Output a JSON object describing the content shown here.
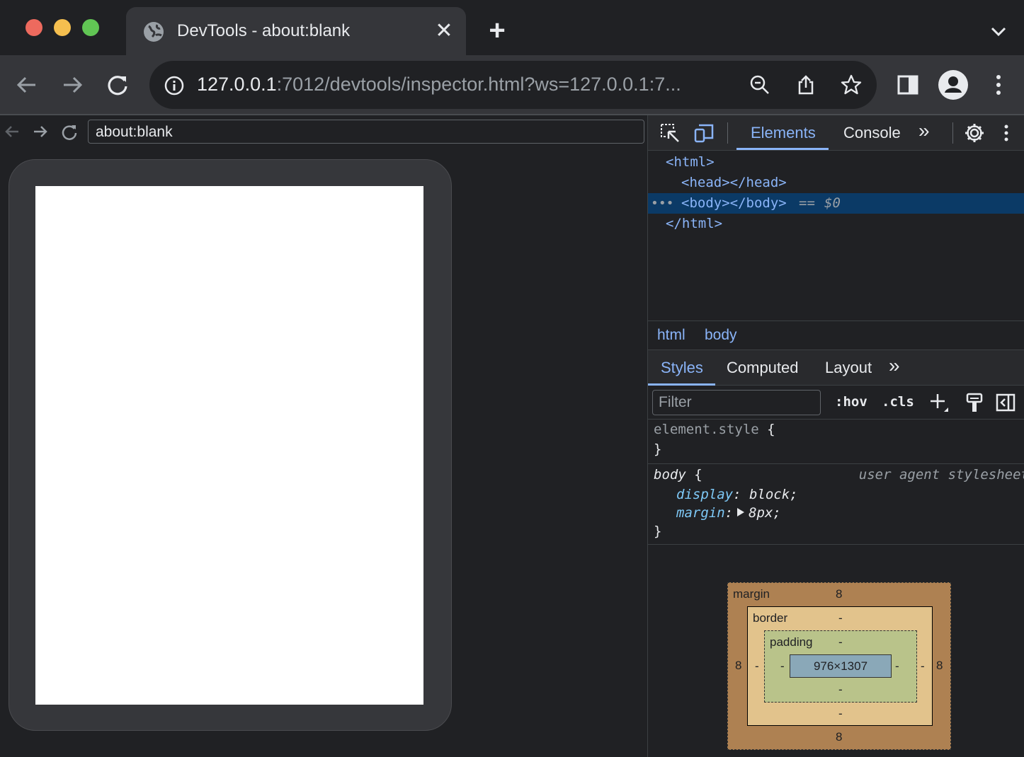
{
  "browser": {
    "tab_title": "DevTools - about:blank",
    "tab_close": "✕",
    "new_tab": "+",
    "url_host": "127.0.0.1",
    "url_rest": ":7012/devtools/inspector.html?ws=127.0.0.1:7..."
  },
  "screencast": {
    "url": "about:blank"
  },
  "devtools": {
    "tabs": [
      "Elements",
      "Console"
    ],
    "more_tabs": "»",
    "dom": {
      "line1": "<html>",
      "line2": "<head></head>",
      "line3": "<body></body>",
      "line3_eq": "==",
      "line3_ref": "$0",
      "line3_dots": "•••",
      "line4": "</html>"
    },
    "breadcrumbs": [
      "html",
      "body"
    ],
    "side_tabs": [
      "Styles",
      "Computed",
      "Layout"
    ],
    "side_more": "»",
    "filter_placeholder": "Filter",
    "hov": ":hov",
    "cls": ".cls",
    "styles": {
      "element_style_selector": "element.style",
      "open_brace": "{",
      "close_brace": "}",
      "body_selector": "body",
      "ua_source": "user agent stylesheet",
      "prop1_name": "display",
      "prop1_value": "block;",
      "prop2_name": "margin",
      "prop2_value": "8px;",
      "colon": ":"
    },
    "box_model": {
      "margin_label": "margin",
      "margin_top": "8",
      "margin_bottom": "8",
      "margin_left": "8",
      "margin_right": "8",
      "border_label": "border",
      "border_top": "-",
      "border_bottom": "-",
      "border_left": "-",
      "border_right": "-",
      "padding_label": "padding",
      "padding_top": "-",
      "padding_bottom": "-",
      "padding_left": "-",
      "padding_right": "-",
      "content": "976×1307"
    }
  },
  "colors": {
    "accent": "#8ab4f8",
    "selected_row": "#0b3a66",
    "margin_box": "#ae8152",
    "border_box": "#e2c38c",
    "padding_box": "#b9c38a",
    "content_box": "#8aa8b8"
  }
}
